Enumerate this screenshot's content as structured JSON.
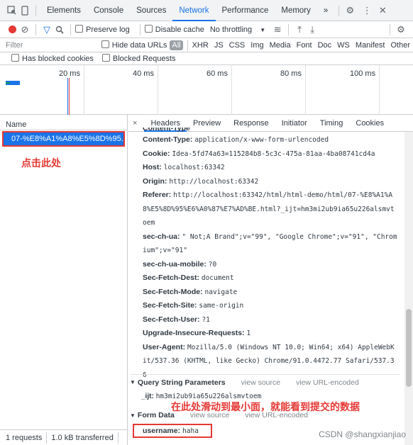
{
  "tabs": [
    "Elements",
    "Console",
    "Sources",
    "Network",
    "Performance",
    "Memory"
  ],
  "more_tabs": "»",
  "toolbar": {
    "preserve_log": "Preserve log",
    "disable_cache": "Disable cache",
    "throttling": "No throttling"
  },
  "filter": {
    "placeholder": "Filter",
    "hide_data_urls": "Hide data URLs",
    "all": "All",
    "types": [
      "XHR",
      "JS",
      "CSS",
      "Img",
      "Media",
      "Font",
      "Doc",
      "WS",
      "Manifest",
      "Other"
    ],
    "has_blocked_cookies": "Has blocked cookies",
    "blocked_requests": "Blocked Requests"
  },
  "timeline": {
    "ticks": [
      "20 ms",
      "40 ms",
      "60 ms",
      "80 ms",
      "100 ms"
    ]
  },
  "left": {
    "name_header": "Name",
    "request_name": "07-%E8%A1%A8%E5%8D%95...",
    "annotation": "点击此处",
    "status_requests": "1 requests",
    "status_transferred": "1.0 kB transferred"
  },
  "details": {
    "close": "×",
    "tabs": [
      "Headers",
      "Preview",
      "Response",
      "Initiator",
      "Timing",
      "Cookies"
    ],
    "partial_top": "Content-Type",
    "headers": [
      {
        "k": "Content-Type:",
        "v": "application/x-www-form-urlencoded"
      },
      {
        "k": "Cookie:",
        "v": "Idea-5fd74a63=115284b8-5c3c-475a-81aa-4ba08741cd4a"
      },
      {
        "k": "Host:",
        "v": "localhost:63342"
      },
      {
        "k": "Origin:",
        "v": "http://localhost:63342"
      },
      {
        "k": "Referer:",
        "v": "http://localhost:63342/html/html-demo/html/07-%E8%A1%A8%E5%8D%95%E6%A0%87%E7%AD%BE.html?_ijt=hm3mi2ub9ia65u226alsmvtoem"
      },
      {
        "k": "sec-ch-ua:",
        "v": "\" Not;A Brand\";v=\"99\", \"Google Chrome\";v=\"91\", \"Chromium\";v=\"91\""
      },
      {
        "k": "sec-ch-ua-mobile:",
        "v": "?0"
      },
      {
        "k": "Sec-Fetch-Dest:",
        "v": "document"
      },
      {
        "k": "Sec-Fetch-Mode:",
        "v": "navigate"
      },
      {
        "k": "Sec-Fetch-Site:",
        "v": "same-origin"
      },
      {
        "k": "Sec-Fetch-User:",
        "v": "?1"
      },
      {
        "k": "Upgrade-Insecure-Requests:",
        "v": "1"
      },
      {
        "k": "User-Agent:",
        "v": "Mozilla/5.0 (Windows NT 10.0; Win64; x64) AppleWebKit/537.36 (KHTML, like Gecko) Chrome/91.0.4472.77 Safari/537.36"
      }
    ],
    "query_string": {
      "title": "Query String Parameters",
      "view_source": "view source",
      "view_url_encoded": "view URL-encoded"
    },
    "ijt_param": {
      "k": "_ijt:",
      "v": "hm3mi2ub9ia65u226alsmvtoem"
    },
    "form_data": {
      "title": "Form Data",
      "view_source": "view source",
      "view_url_encoded": "view URL-encoded"
    },
    "username": {
      "k": "username:",
      "v": "haha"
    },
    "annotation": "在此处滑动到最小面，就能看到提交的数据"
  },
  "watermark": "CSDN @shangxianjiao",
  "colors": {
    "accent": "#1a73e8",
    "annotation": "#e53935"
  }
}
